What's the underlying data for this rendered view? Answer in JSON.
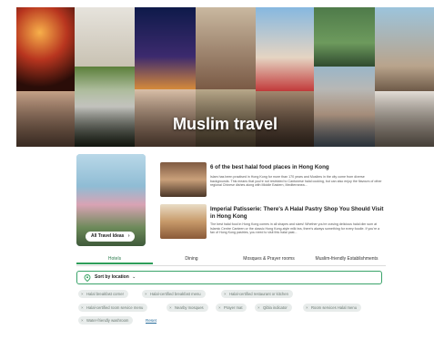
{
  "hero": {
    "title": "Muslim travel",
    "colors": [
      "#c44a2a",
      "#d9d6cf",
      "#1d2a5e",
      "#b6a58e",
      "#7fb0d6",
      "#3d5a3e",
      "#9bc2d4",
      "#4a6f2f",
      "#6b4c3a",
      "#c79e87",
      "#2f4f4f",
      "#a99a86",
      "#dcb18a",
      "#8a6d55",
      "#566b80",
      "#b88c6a"
    ]
  },
  "feature": {
    "button_label": "All Travel Ideas"
  },
  "articles": [
    {
      "title": "6 of the best halal food places in Hong Kong",
      "description": "Islam has been practised in Hong Kong for more than 170 years and Muslims in the city come from diverse backgrounds. This means that you're not restricted to Cantonese halal cooking, but can also enjoy the flavours of other regional Chinese dishes along with Middle Eastern, Mediterranea..."
    },
    {
      "title": "Imperial Patisserie: There's A Halal Pastry Shop You Should Visit in Hong Kong",
      "description": "The best halal food in Hong Kong comes in all shapes and sizes! Whether you're craving delicious halal dim sum at Islamic Centre Canteen or the classic Hong Kong-style milk tea, there's always something for every foodie. If you're a fan of Hong Kong pastries, you need to visit this halal past..."
    }
  ],
  "tabs": [
    "Hotels",
    "Dining",
    "Mosques & Prayer rooms",
    "Muslim-friendly Establishments"
  ],
  "active_tab": "Hotels",
  "sort": {
    "label": "Sort by location"
  },
  "filters": [
    "Halal breakfast corner",
    "Halal-certified breakfast menu",
    "Halal-certified restaurant or kitchen",
    "Halal-certified room service menu",
    "Nearby mosques",
    "Prayer mat",
    "Qibla indicator",
    "Room services Halal menu",
    "Water-friendly washroom"
  ],
  "reset_label": "Reset",
  "accent_color": "#2e9e5a"
}
